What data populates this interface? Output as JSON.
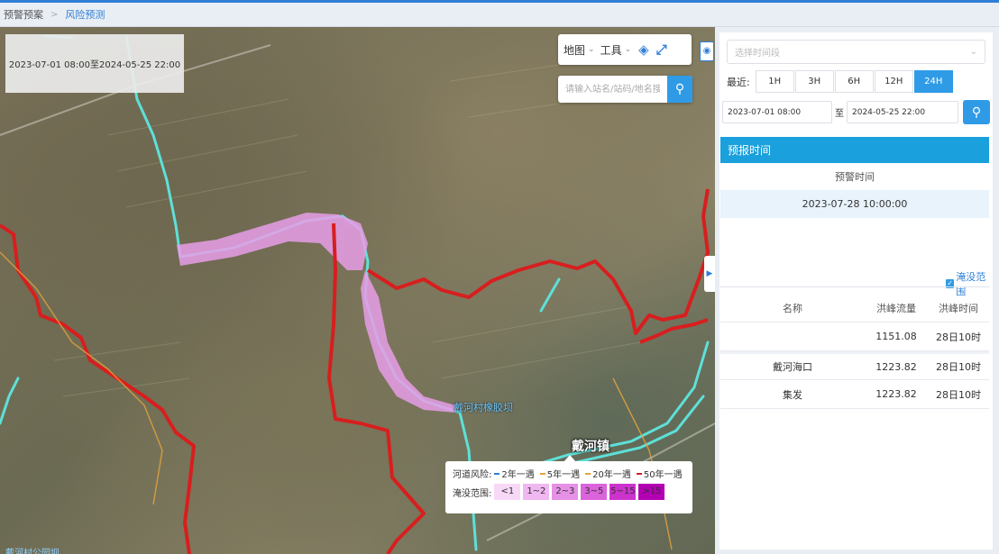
{
  "breadcrumb": {
    "home": "预警预案",
    "separator": ">",
    "current": "风险预测"
  },
  "map": {
    "time_range_text": "2023-07-01 08:00至2024-05-25 22:00",
    "toolbar": {
      "map_label": "地图",
      "tools_label": "工具",
      "globe_icon": "globe-icon",
      "fullscreen_icon": "fullscreen-icon"
    },
    "search": {
      "placeholder": "请输入站名/站码/地名搜索",
      "icon": "search-icon"
    },
    "place_label": "戴河镇",
    "station_label": "戴河村橡胶坝",
    "bottom_label": "戴河村公园坝"
  },
  "legend": {
    "river_risk_label": "河道风险:",
    "river_items": [
      {
        "label": "2年一遇",
        "color": "#2f7fd6"
      },
      {
        "label": "5年一遇",
        "color": "#e6a23c"
      },
      {
        "label": "20年一遇",
        "color": "#e6a23c"
      },
      {
        "label": "50年一遇",
        "color": "#d81e1e"
      }
    ],
    "flood_range_label": "淹没范围:",
    "flood_items": [
      {
        "label": "<1",
        "color": "#f7d9f7"
      },
      {
        "label": "1~2",
        "color": "#f0b8f0"
      },
      {
        "label": "2~3",
        "color": "#e690e6"
      },
      {
        "label": "3~5",
        "color": "#db63db"
      },
      {
        "label": "5~15",
        "color": "#cc33cc"
      },
      {
        "label": ">15",
        "color": "#b300b3"
      }
    ]
  },
  "panel": {
    "period_select_placeholder": "选择时间段",
    "recent_label": "最近:",
    "recent_options": [
      "1H",
      "3H",
      "6H",
      "12H",
      "24H"
    ],
    "active_option": "24H",
    "start_date": "2023-07-01 08:00",
    "to_label": "至",
    "end_date": "2024-05-25 22:00",
    "forecast_header": "预报时间",
    "warning_time_label": "预警时间",
    "warning_time_value": "2023-07-28 10:00:00",
    "flood_checkbox_label": "淹没范围",
    "table": {
      "headers": [
        "名称",
        "洪峰流量",
        "洪峰时间"
      ],
      "rows": [
        {
          "name": "",
          "flow": "1151.08",
          "time": "28日10时"
        },
        {
          "name": "戴河海口",
          "flow": "1223.82",
          "time": "28日10时"
        },
        {
          "name": "集发",
          "flow": "1223.82",
          "time": "28日10时"
        }
      ]
    }
  },
  "colors": {
    "accent": "#2f9be6",
    "risk_line": "#d81e1e",
    "river": "#5ee0d8",
    "flood": "#e79ee7"
  }
}
